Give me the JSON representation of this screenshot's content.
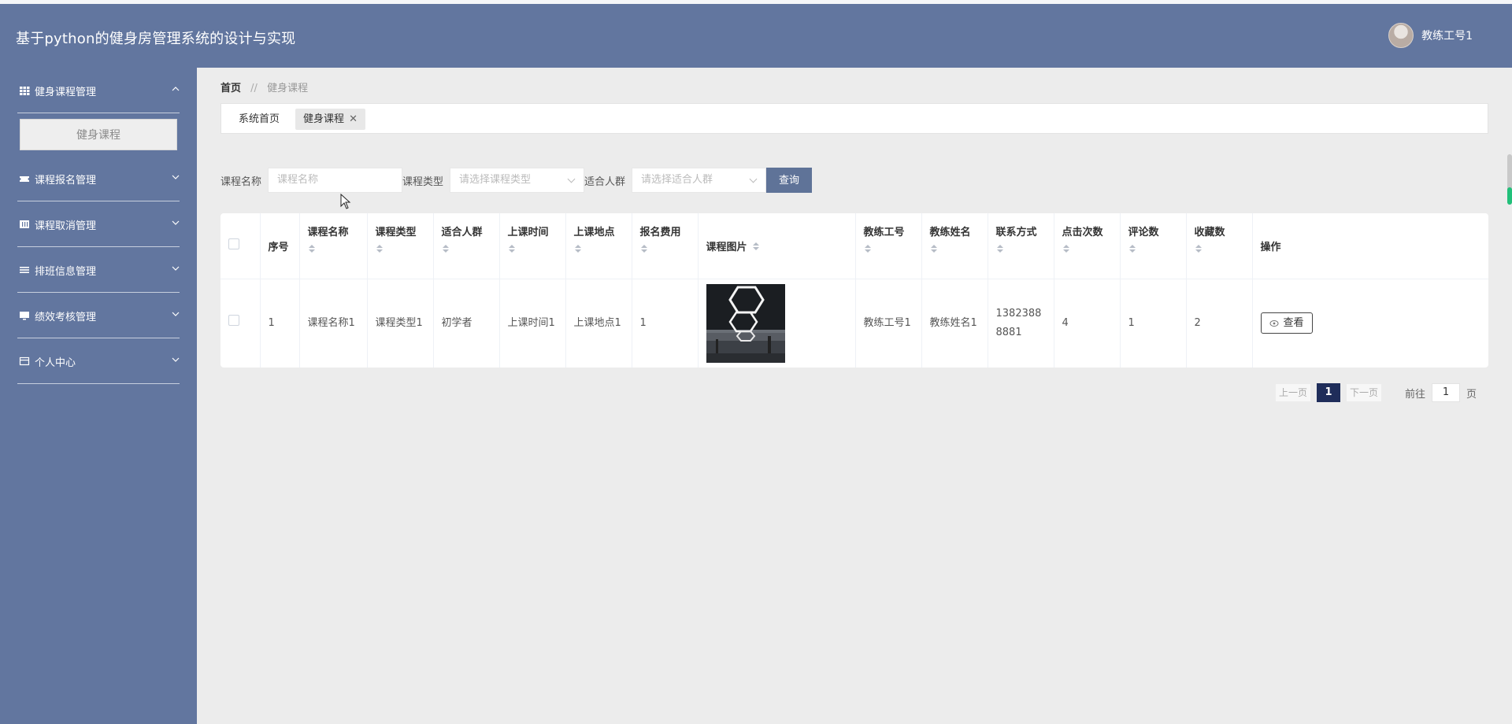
{
  "app": {
    "title": "基于python的健身房管理系统的设计与实现",
    "user_name": "教练工号1"
  },
  "sidebar": {
    "groups": [
      {
        "label": "健身课程管理",
        "icon": "grid-icon",
        "expanded": true,
        "items": [
          {
            "label": "健身课程"
          }
        ]
      },
      {
        "label": "课程报名管理",
        "icon": "ticket-icon",
        "expanded": false
      },
      {
        "label": "课程取消管理",
        "icon": "columns-icon",
        "expanded": false
      },
      {
        "label": "排班信息管理",
        "icon": "list-icon",
        "expanded": false
      },
      {
        "label": "绩效考核管理",
        "icon": "monitor-icon",
        "expanded": false
      },
      {
        "label": "个人中心",
        "icon": "card-icon",
        "expanded": false
      }
    ]
  },
  "breadcrumb": {
    "home": "首页",
    "separator": "//",
    "current": "健身课程"
  },
  "tabs": [
    {
      "label": "系统首页"
    },
    {
      "label": "健身课程",
      "active": true
    }
  ],
  "search": {
    "name_label": "课程名称",
    "name_placeholder": "课程名称",
    "type_label": "课程类型",
    "type_placeholder": "请选择课程类型",
    "crowd_label": "适合人群",
    "crowd_placeholder": "请选择适合人群",
    "query_button": "查询"
  },
  "table": {
    "columns": [
      "序号",
      "课程名称",
      "课程类型",
      "适合人群",
      "上课时间",
      "上课地点",
      "报名费用",
      "课程图片",
      "教练工号",
      "教练姓名",
      "联系方式",
      "点击次数",
      "评论数",
      "收藏数",
      "操作"
    ],
    "rows": [
      {
        "index": "1",
        "name": "课程名称1",
        "type": "课程类型1",
        "crowd": "初学者",
        "time": "上课时间1",
        "place": "上课地点1",
        "fee": "1",
        "coach_id": "教练工号1",
        "coach_name": "教练姓名1",
        "phone": "13823888881",
        "clicks": "4",
        "comments": "1",
        "favorites": "2",
        "action": "查看"
      }
    ]
  },
  "pagination": {
    "prev": "上一页",
    "current": "1",
    "next": "下一页",
    "goto_label": "前往",
    "goto_value": "1",
    "page_suffix": "页"
  },
  "colors": {
    "header": "#62769f",
    "sidebar": "#62769f",
    "query_button": "#5f7398",
    "current_page": "#1f2d5a"
  }
}
